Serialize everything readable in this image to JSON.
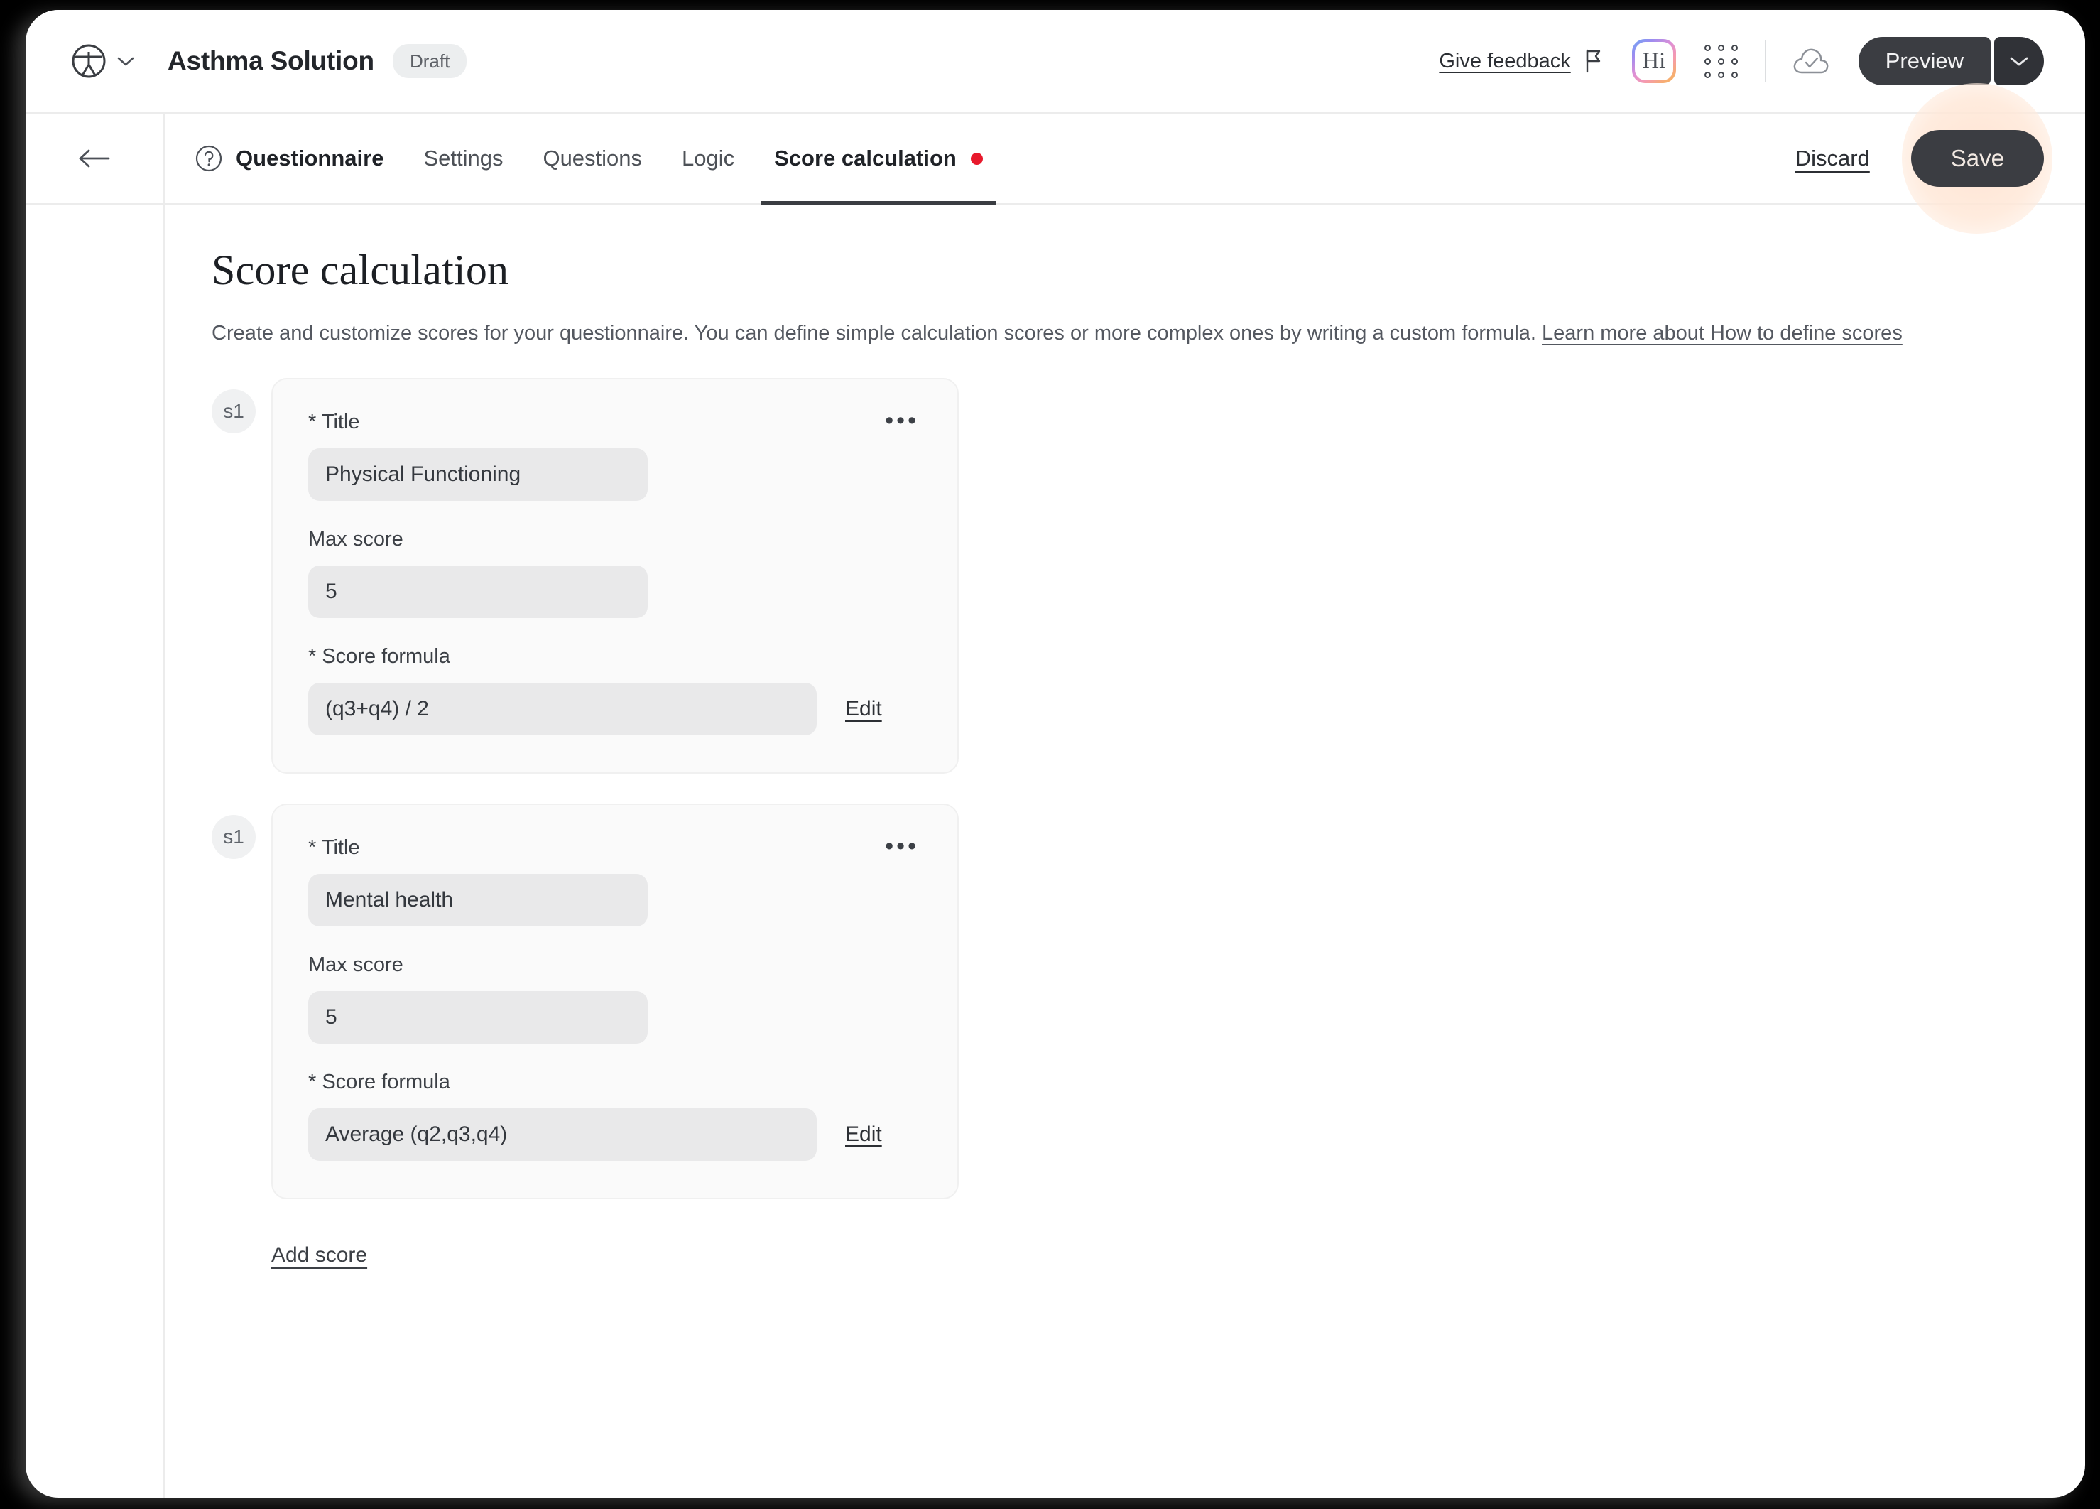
{
  "topbar": {
    "logo_icon": "vitruvian-person-logo",
    "workspace_caret_icon": "chevron-down-icon",
    "doc_title": "Asthma Solution",
    "status_pill": "Draft",
    "give_feedback": "Give feedback",
    "flag_icon": "flag-icon",
    "assistant_badge": "Hi",
    "apps_icon": "grid-apps-icon",
    "save_state_icon": "cloud-check-icon",
    "preview_label": "Preview",
    "preview_caret_icon": "chevron-down-icon"
  },
  "nav": {
    "back_icon": "arrow-left-icon",
    "help_icon": "question-circle-icon",
    "tabs": [
      {
        "label": "Questionnaire",
        "active": false,
        "has_icon": true,
        "dot": false
      },
      {
        "label": "Settings",
        "active": false,
        "has_icon": false,
        "dot": false
      },
      {
        "label": "Questions",
        "active": false,
        "has_icon": false,
        "dot": false
      },
      {
        "label": "Logic",
        "active": false,
        "has_icon": false,
        "dot": false
      },
      {
        "label": "Score calculation",
        "active": true,
        "has_icon": false,
        "dot": true
      }
    ],
    "discard_label": "Discard",
    "save_label": "Save",
    "unsaved_dot_color": "#e8192c",
    "click_highlight_color": "#ffe2d0"
  },
  "page": {
    "title": "Score calculation",
    "description_lead": "Create and customize scores for your questionnaire. You can define simple calculation scores or more complex ones by writing a custom formula. ",
    "description_link": "Learn more about How to define scores"
  },
  "labels": {
    "title_label": "* Title",
    "max_score_label": "Max score",
    "formula_label": "* Score formula",
    "edit_label": "Edit",
    "menu_icon": "ellipsis-horizontal-icon"
  },
  "scores": [
    {
      "badge": "s1",
      "title": "Physical Functioning",
      "max_score": "5",
      "formula": "(q3+q4) / 2"
    },
    {
      "badge": "s1",
      "title": "Mental health",
      "max_score": "5",
      "formula": "Average (q2,q3,q4)"
    }
  ],
  "footer": {
    "add_score_label": "Add score"
  }
}
